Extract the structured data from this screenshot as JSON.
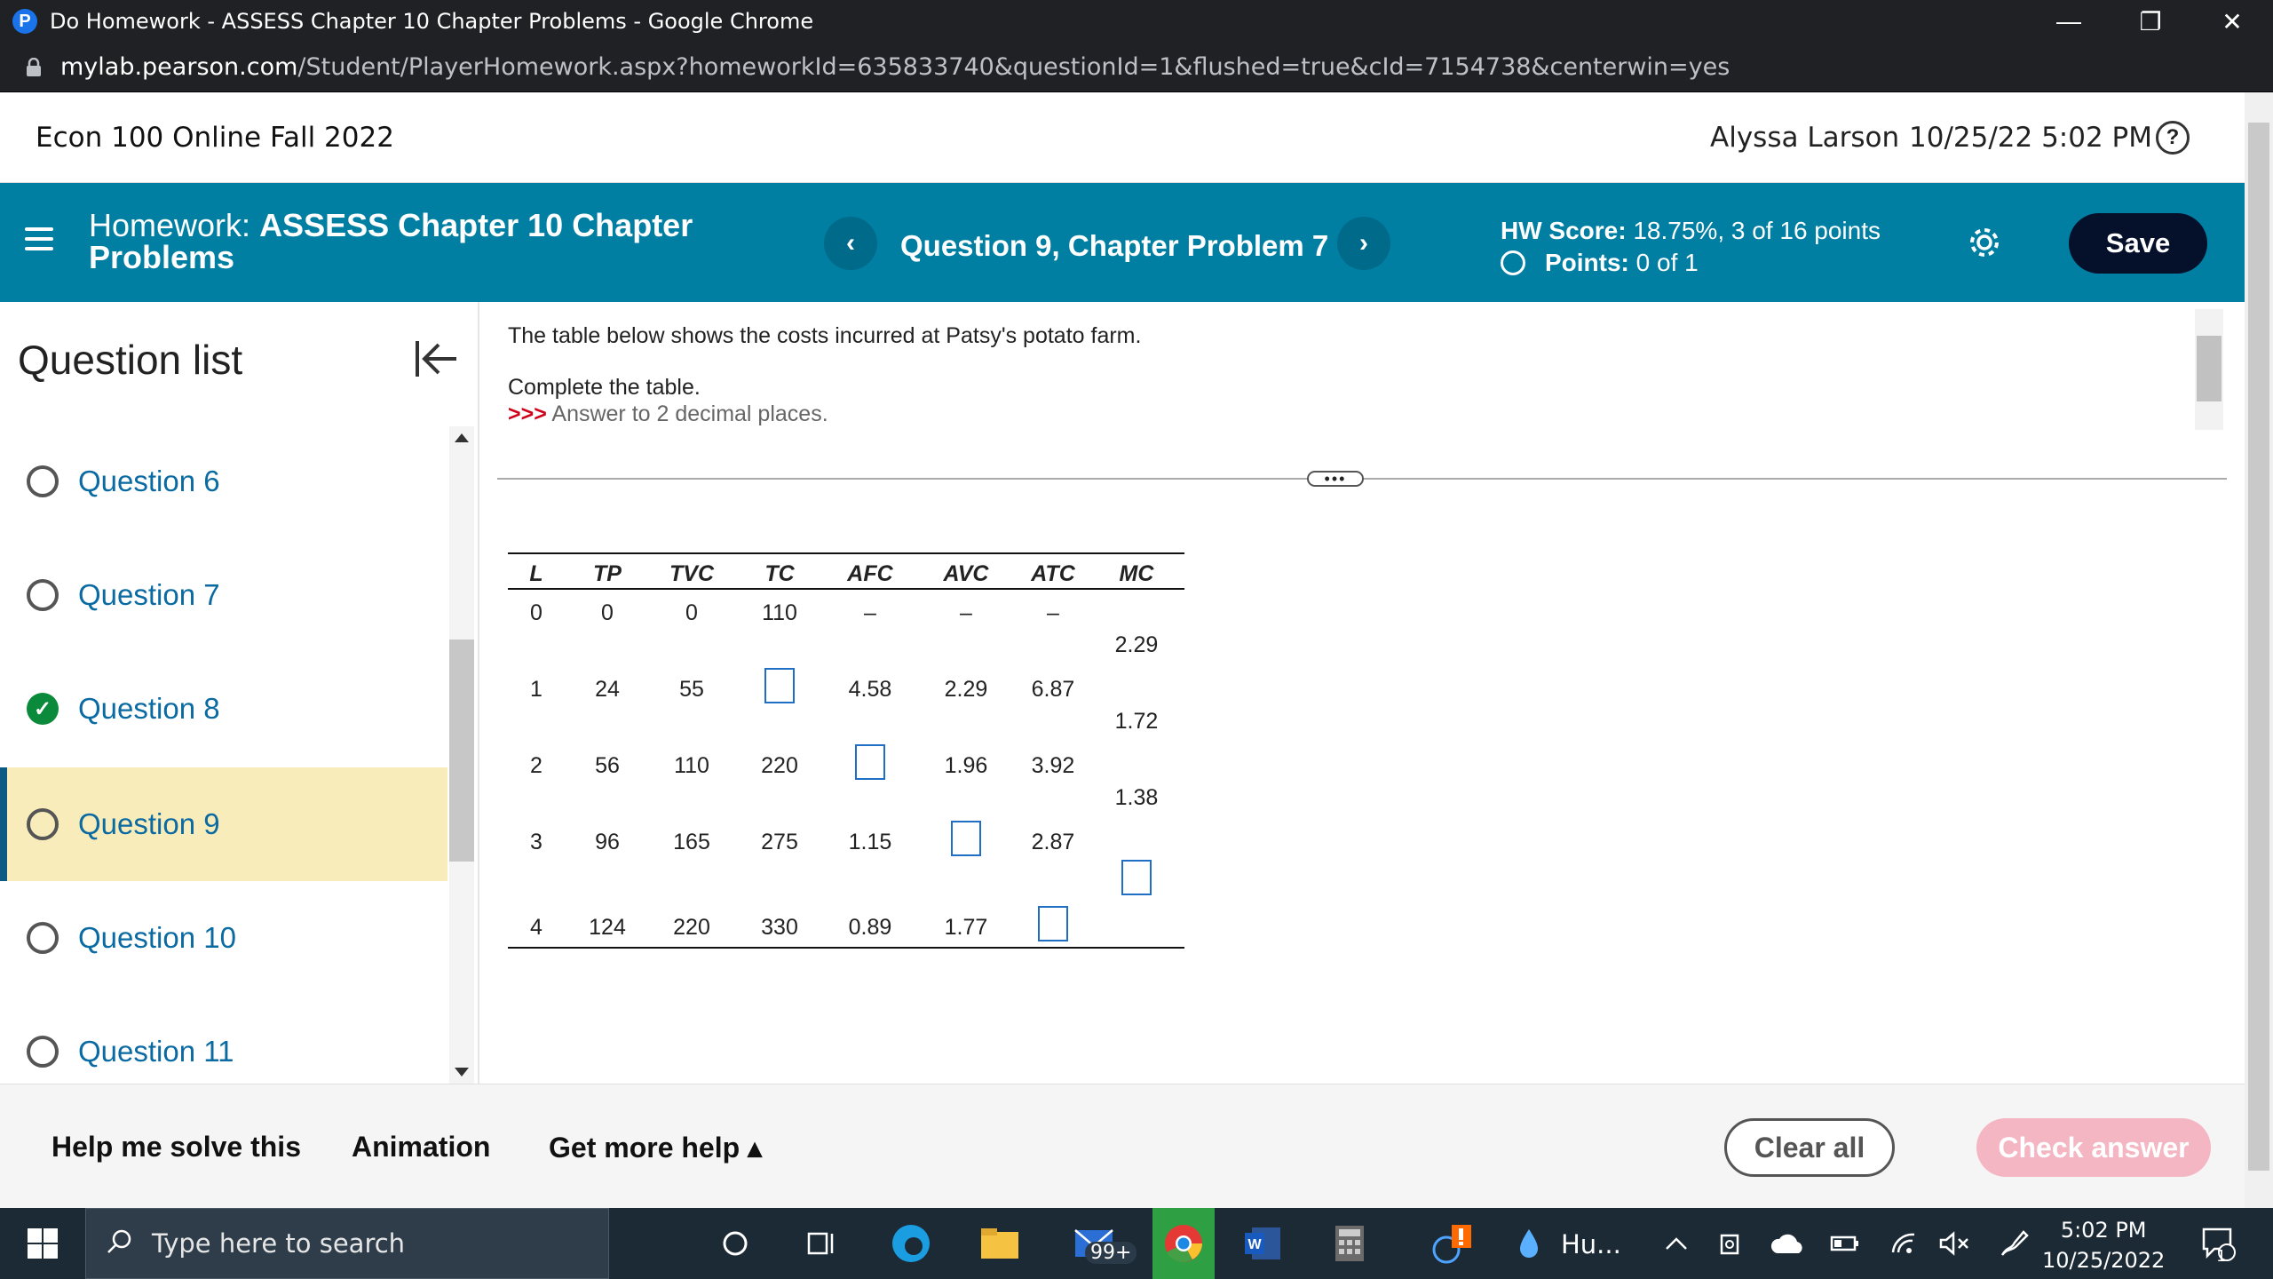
{
  "browser": {
    "window_title": "Do Homework - ASSESS Chapter 10 Chapter Problems - Google Chrome",
    "url_host": "mylab.pearson.com",
    "url_path": "/Student/PlayerHomework.aspx?homeworkId=635833740&questionId=1&flushed=true&cId=7154738&centerwin=yes",
    "controls": {
      "minimize": "—",
      "restore": "❐",
      "close": "✕"
    }
  },
  "course_header": {
    "course_name": "Econ 100 Online Fall 2022",
    "user_name": "Alyssa Larson",
    "datetime": "10/25/22 5:02 PM",
    "help_glyph": "?"
  },
  "hw_bar": {
    "homework_label": "Homework:",
    "homework_name": "ASSESS Chapter 10 Chapter Problems",
    "prev_glyph": "‹",
    "next_glyph": "›",
    "question_title": "Question 9, Chapter Problem 7",
    "hw_score_label": "HW Score:",
    "hw_score_value": "18.75%, 3 of 16 points",
    "points_label": "Points:",
    "points_value": "0 of 1",
    "save_label": "Save",
    "accent_color": "#007fa3"
  },
  "sidebar": {
    "header": "Question list",
    "items": [
      {
        "label": "Question 6",
        "status": "unanswered"
      },
      {
        "label": "Question 7",
        "status": "unanswered"
      },
      {
        "label": "Question 8",
        "status": "correct"
      },
      {
        "label": "Question 9",
        "status": "current"
      },
      {
        "label": "Question 10",
        "status": "unanswered"
      },
      {
        "label": "Question 11",
        "status": "unanswered"
      }
    ]
  },
  "question": {
    "intro": "The table below shows the costs incurred at Patsy's potato farm.",
    "instruction": "Complete the table.",
    "hint_arrows": ">>>",
    "hint": "Answer to 2 decimal places.",
    "divider_handle": "•••",
    "table": {
      "headers": [
        "L",
        "TP",
        "TVC",
        "TC",
        "AFC",
        "AVC",
        "ATC",
        "MC"
      ],
      "rows": [
        [
          "0",
          "0",
          "0",
          "110",
          "–",
          "–",
          "–"
        ],
        [
          "1",
          "24",
          "55",
          "",
          "4.58",
          "2.29",
          "6.87"
        ],
        [
          "2",
          "56",
          "110",
          "220",
          "",
          "1.96",
          "3.92"
        ],
        [
          "3",
          "96",
          "165",
          "275",
          "1.15",
          "",
          "2.87"
        ],
        [
          "4",
          "124",
          "220",
          "330",
          "0.89",
          "1.77",
          ""
        ]
      ],
      "mc_values": [
        "2.29",
        "1.72",
        "1.38",
        ""
      ]
    }
  },
  "footer": {
    "help_me_solve": "Help me solve this",
    "animation": "Animation",
    "get_more_help": "Get more help ▴",
    "clear_all": "Clear all",
    "check_answer": "Check answer"
  },
  "taskbar": {
    "search_placeholder": "Type here to search",
    "mail_badge": "99+",
    "weather_text": "Hu...",
    "time": "5:02 PM",
    "date": "10/25/2022",
    "notification_count": "1"
  }
}
